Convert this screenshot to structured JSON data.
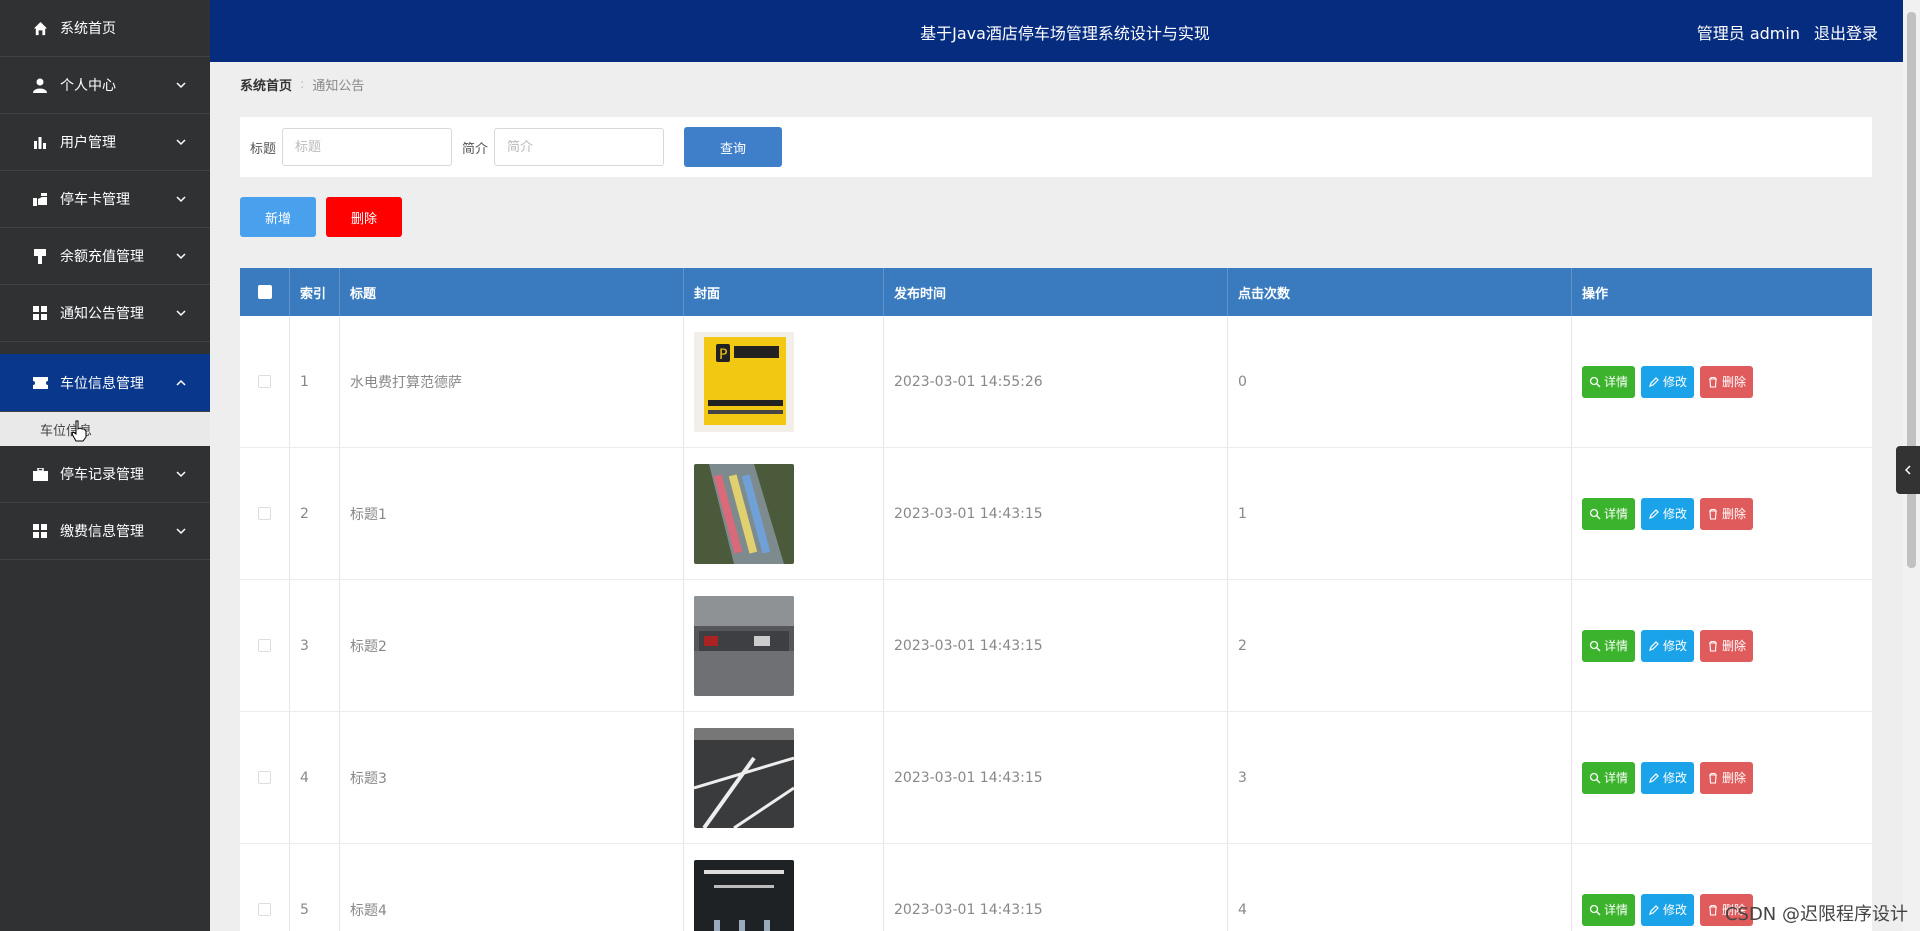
{
  "sidebar": {
    "items": [
      {
        "label": "系统首页",
        "icon": "home-icon"
      },
      {
        "label": "个人中心",
        "icon": "person-icon"
      },
      {
        "label": "用户管理",
        "icon": "bar-chart-icon"
      },
      {
        "label": "停车卡管理",
        "icon": "hand-card-icon"
      },
      {
        "label": "余额充值管理",
        "icon": "pin-icon"
      },
      {
        "label": "通知公告管理",
        "icon": "grid-icon"
      },
      {
        "label": "车位信息管理",
        "icon": "ticket-icon"
      },
      {
        "label": "停车记录管理",
        "icon": "briefcase-icon"
      },
      {
        "label": "缴费信息管理",
        "icon": "grid-icon"
      }
    ],
    "sub_item": "车位信息"
  },
  "header": {
    "title": "基于Java酒店停车场管理系统设计与实现",
    "user": "管理员 admin",
    "logout": "退出登录"
  },
  "breadcrumb": {
    "home": "系统首页",
    "current": "通知公告"
  },
  "search": {
    "title_label": "标题",
    "title_placeholder": "标题",
    "intro_label": "简介",
    "intro_placeholder": "简介",
    "query_button": "查询"
  },
  "actions": {
    "add": "新增",
    "delete": "删除"
  },
  "table": {
    "headers": [
      "索引",
      "标题",
      "封面",
      "发布时间",
      "点击次数",
      "操作"
    ],
    "rows": [
      {
        "index": "1",
        "title": "水电费打算范德萨",
        "time": "2023-03-01 14:55:26",
        "clicks": "0"
      },
      {
        "index": "2",
        "title": "标题1",
        "time": "2023-03-01 14:43:15",
        "clicks": "1"
      },
      {
        "index": "3",
        "title": "标题2",
        "time": "2023-03-01 14:43:15",
        "clicks": "2"
      },
      {
        "index": "4",
        "title": "标题3",
        "time": "2023-03-01 14:43:15",
        "clicks": "3"
      },
      {
        "index": "5",
        "title": "标题4",
        "time": "2023-03-01 14:43:15",
        "clicks": "4"
      }
    ],
    "op_labels": {
      "detail": "详情",
      "edit": "修改",
      "remove": "删除"
    }
  },
  "watermark": "CSDN @迟限程序设计",
  "colors": {
    "sidebar": "#2f3133",
    "topbar": "#062c80",
    "active": "#08378c",
    "table_header": "#3a7bbf",
    "detail": "#3bb32c",
    "edit": "#1aa3e8",
    "remove": "#e05c5c",
    "delete_btn": "#ff0000",
    "add_btn": "#49a1ee"
  }
}
